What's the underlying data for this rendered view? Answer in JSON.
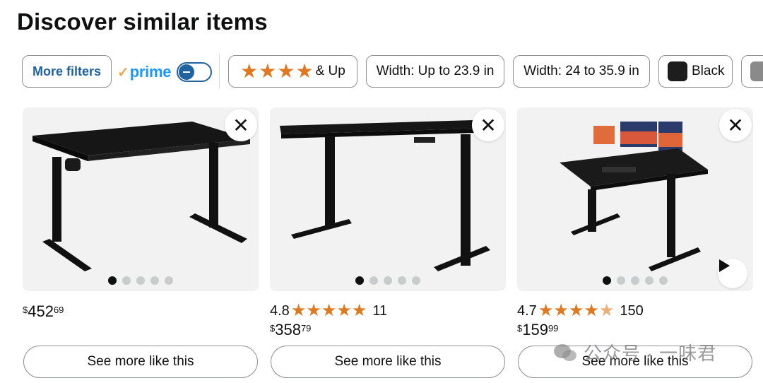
{
  "page_title": "Discover similar items",
  "filters": {
    "more_filters": "More filters",
    "prime_label": "prime",
    "prime_check": "✓",
    "stars_suffix": "& Up",
    "width_1": "Width: Up to 23.9 in",
    "width_2": "Width: 24 to 35.9 in",
    "color_black": "Black",
    "colors": {
      "black": "#1d1d1d",
      "grey": "#8a8a8a"
    }
  },
  "products": [
    {
      "rating": "",
      "review_count": "",
      "price_symbol": "$",
      "price_whole": "452",
      "price_fraction": "69",
      "see_more": "See more like this",
      "image_dots": 5
    },
    {
      "rating": "4.8",
      "review_count": "11",
      "price_symbol": "$",
      "price_whole": "358",
      "price_fraction": "79",
      "see_more": "See more like this",
      "image_dots": 5
    },
    {
      "rating": "4.7",
      "review_count": "150",
      "price_symbol": "$",
      "price_whole": "159",
      "price_fraction": "99",
      "see_more": "See more like this",
      "image_dots": 5
    }
  ],
  "icons": {
    "close": "✕",
    "star": "★"
  },
  "watermark": "公众号 · 一味君",
  "accent_colors": {
    "link": "#2162a1",
    "star": "#de7921",
    "prime": "#1a98ff"
  }
}
